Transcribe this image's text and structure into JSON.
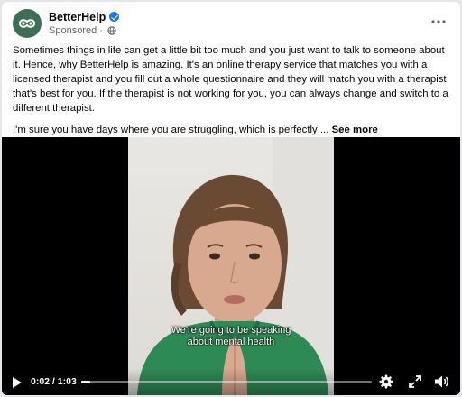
{
  "post": {
    "page_name": "BetterHelp",
    "sponsored_label": "Sponsored",
    "sponsored_separator": "·",
    "body_paragraph_1": "Sometimes things in life can get a little bit too much and you just want to talk to someone about it. Hence, why BetterHelp is amazing. It's an online therapy service that matches you with a licensed therapist and you fill out a whole questionnaire and they will match you with a therapist that's best for you. If the therapist is not working for you, you can always change and switch to a different therapist.",
    "body_paragraph_2": "I'm sure you have days where you are struggling, which is perfectly ...",
    "see_more_label": "See more"
  },
  "icons": {
    "avatar": "betterhelp-logo-icon",
    "verified": "verified-badge-icon",
    "audience": "globe-icon",
    "menu": "more-options-icon",
    "play": "play-icon",
    "settings": "gear-icon",
    "fullscreen": "fullscreen-icon",
    "volume": "volume-icon"
  },
  "video": {
    "caption_line_1": "We're going to be speaking",
    "caption_line_2": "about mental health",
    "current_time": "0:02",
    "time_separator": " / ",
    "duration": "1:03",
    "progress_fraction": 0.032
  },
  "colors": {
    "avatar_bg": "#3d6f57",
    "verified": "#1877f2",
    "hoodie": "#2e8a55"
  }
}
